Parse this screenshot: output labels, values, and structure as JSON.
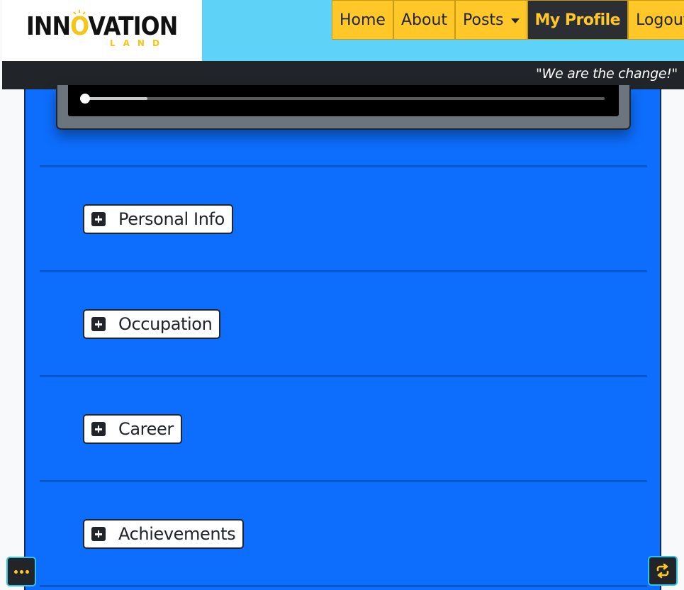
{
  "brand": {
    "name_part1": "INN",
    "name_bulb": "O",
    "name_part2": "VATION",
    "sub": "LAND",
    "tagline": "\"We are the change!\""
  },
  "nav": {
    "items": [
      {
        "label": "Home"
      },
      {
        "label": "About"
      },
      {
        "label": "Posts"
      },
      {
        "label": "My Profile"
      },
      {
        "label": "Logout"
      }
    ]
  },
  "video": {
    "progress": 0.12,
    "buffered": 0.12
  },
  "sections": [
    {
      "label": "Personal Info"
    },
    {
      "label": "Occupation"
    },
    {
      "label": "Career"
    },
    {
      "label": "Achievements"
    }
  ],
  "icons": {
    "expand": "plus-square-icon",
    "more": "ellipsis-icon",
    "toggle": "repeat-icon"
  },
  "colors": {
    "accent": "#ffc728",
    "nav_bg": "#5fd3f7",
    "panel": "#0d6efd",
    "dark": "#212529",
    "fab_border": "#2ec4e8"
  }
}
